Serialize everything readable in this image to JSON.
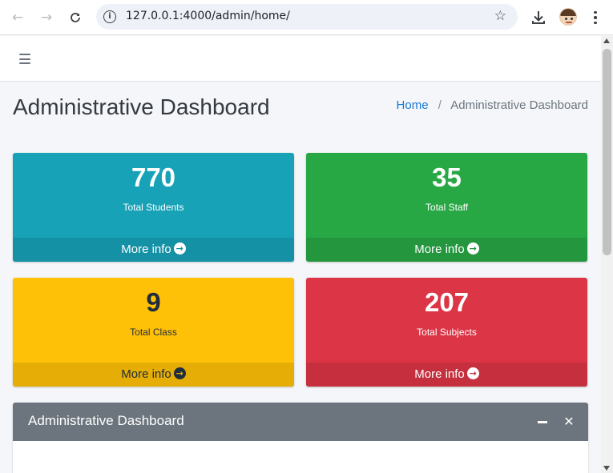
{
  "browser": {
    "url": "127.0.0.1:4000/admin/home/",
    "icons": [
      "back-icon",
      "forward-icon",
      "reload-icon",
      "site-info-icon",
      "bookmark-star-icon",
      "download-icon",
      "profile-avatar",
      "more-menu-icon"
    ]
  },
  "page": {
    "title": "Administrative Dashboard",
    "breadcrumb": {
      "home": "Home",
      "separator": "/",
      "current": "Administrative Dashboard"
    }
  },
  "stats": [
    {
      "value": "770",
      "label": "Total Students",
      "footer": "More info",
      "color": "#17a2b8"
    },
    {
      "value": "35",
      "label": "Total Staff",
      "footer": "More info",
      "color": "#28a745"
    },
    {
      "value": "9",
      "label": "Total Class",
      "footer": "More info",
      "color": "#ffc107"
    },
    {
      "value": "207",
      "label": "Total Subjects",
      "footer": "More info",
      "color": "#dc3545"
    }
  ],
  "card": {
    "title": "Administrative Dashboard",
    "header_color": "#6c757d"
  }
}
